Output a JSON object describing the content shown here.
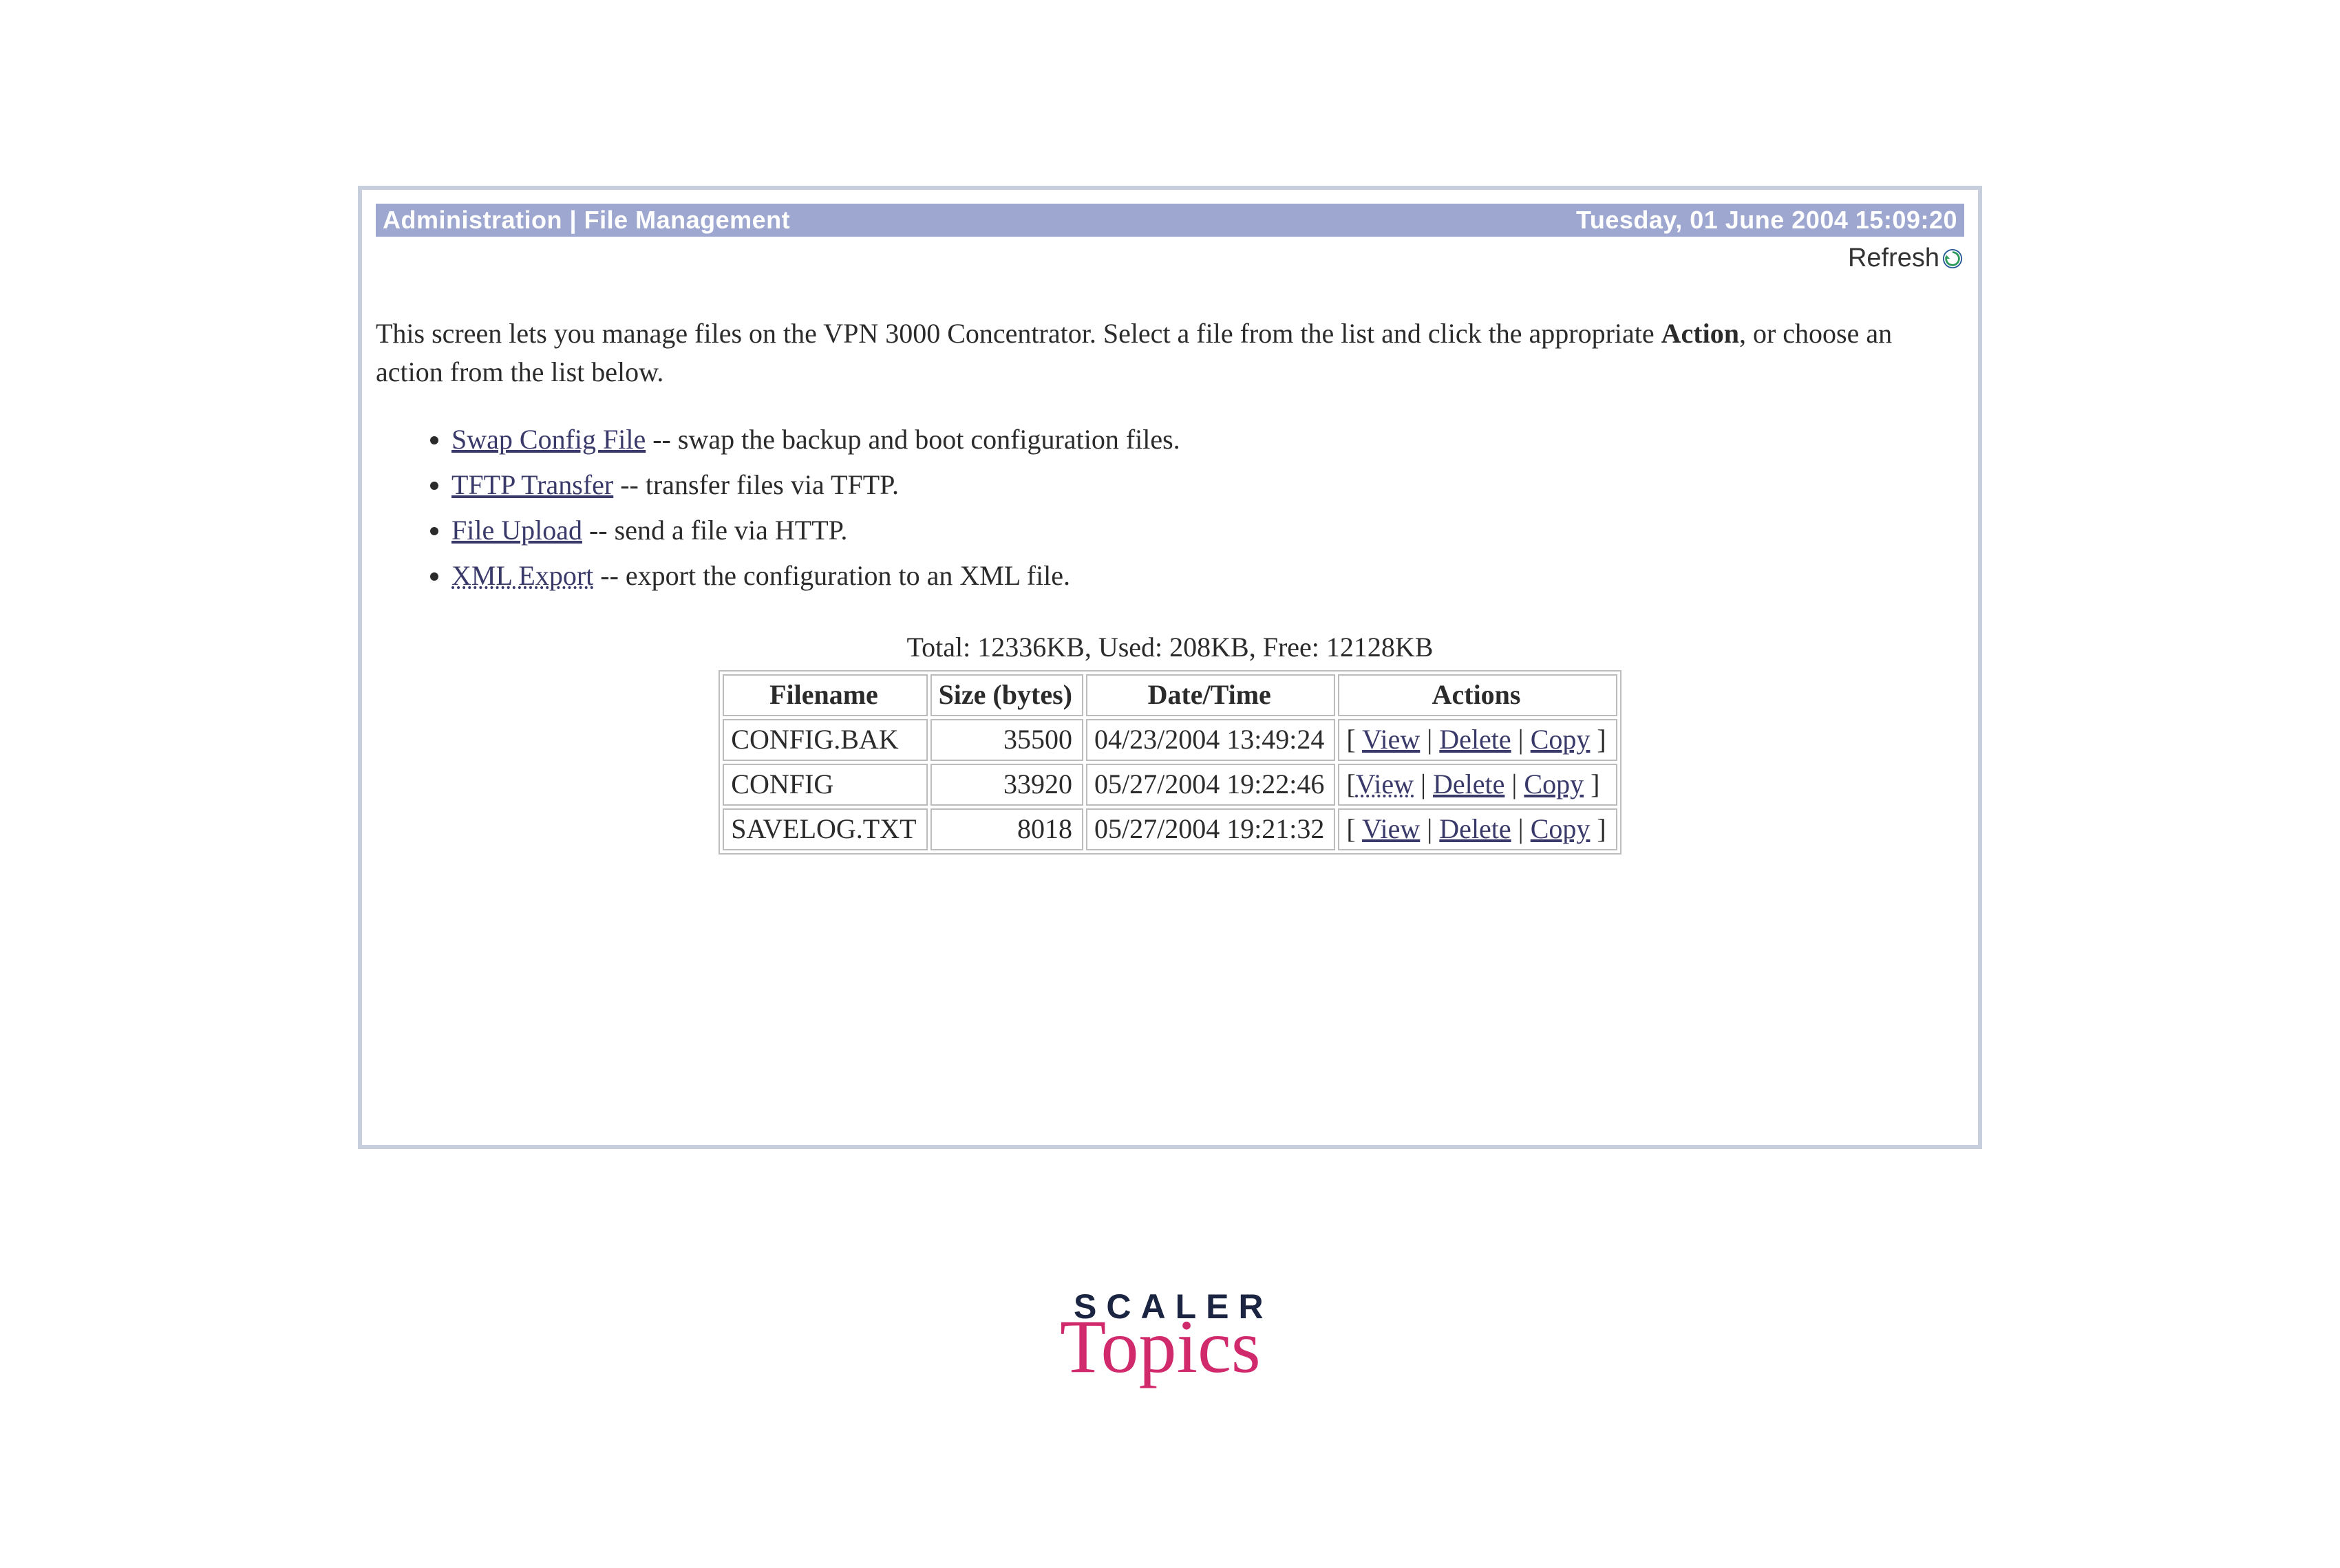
{
  "titlebar": {
    "left": "Administration | File Management",
    "right": "Tuesday, 01 June 2004 15:09:20"
  },
  "refresh": {
    "label": "Refresh"
  },
  "intro": {
    "part1": "This screen lets you manage files on the VPN 3000 Concentrator. Select a file from the list and click the appropriate ",
    "bold": "Action",
    "part2": ", or choose an action from the list below."
  },
  "actions": [
    {
      "link": "Swap Config File",
      "desc": " -- swap the backup and boot configuration files."
    },
    {
      "link": "TFTP Transfer",
      "desc": " -- transfer files via TFTP."
    },
    {
      "link": "File Upload",
      "desc": " -- send a file via HTTP."
    },
    {
      "link": "XML Export",
      "desc": " -- export the configuration to an XML file."
    }
  ],
  "storage_line": "Total: 12336KB, Used: 208KB, Free: 12128KB",
  "table": {
    "headers": {
      "filename": "Filename",
      "size": "Size (bytes)",
      "datetime": "Date/Time",
      "actions": "Actions"
    },
    "action_labels": {
      "view": "View",
      "delete": "Delete",
      "copy": "Copy"
    },
    "rows": [
      {
        "filename": "CONFIG.BAK",
        "size": "35500",
        "datetime": "04/23/2004 13:49:24"
      },
      {
        "filename": "CONFIG",
        "size": "33920",
        "datetime": "05/27/2004 19:22:46"
      },
      {
        "filename": "SAVELOG.TXT",
        "size": "8018",
        "datetime": "05/27/2004 19:21:32"
      }
    ]
  },
  "branding": {
    "line1": "SCALER",
    "line2": "Topics"
  }
}
